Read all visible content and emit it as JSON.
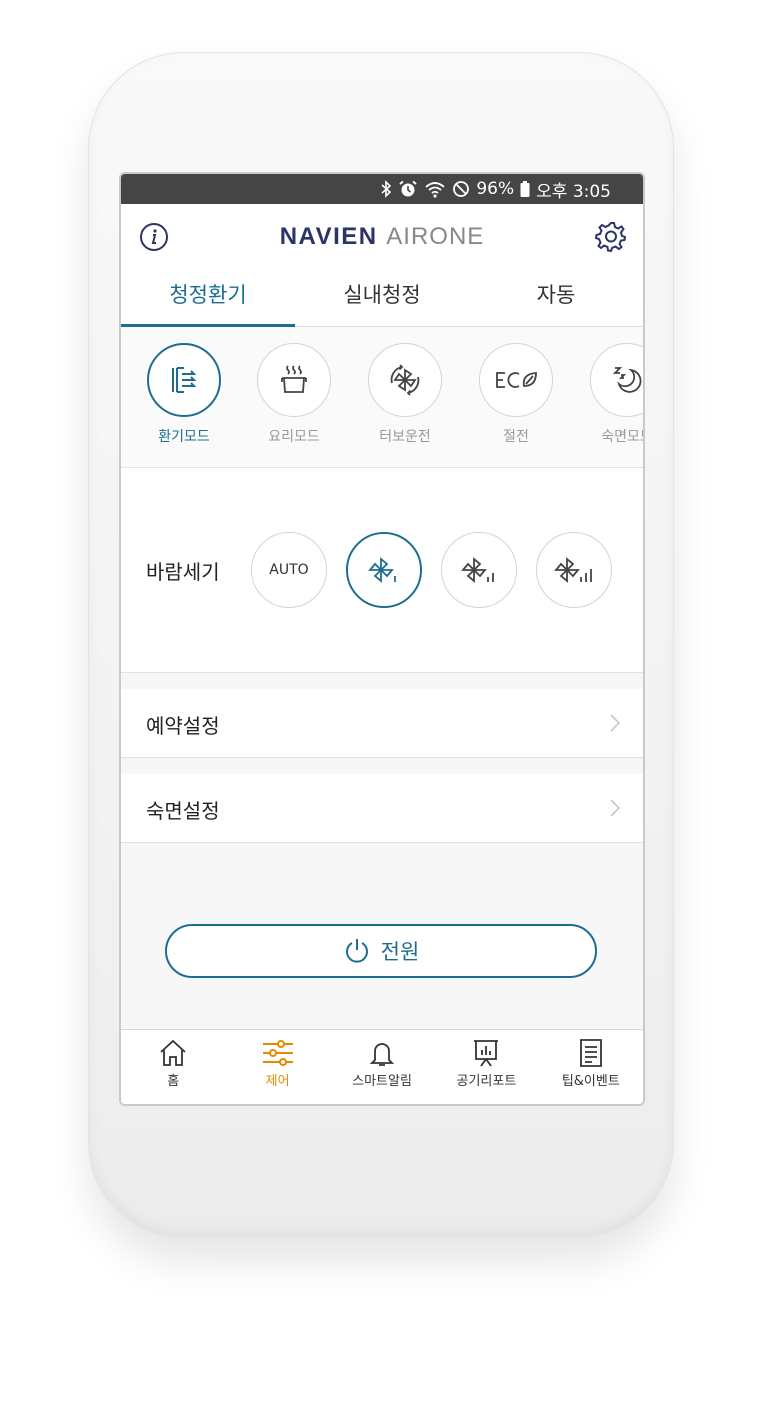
{
  "statusbar": {
    "battery": "96%",
    "time": "오후 3:05"
  },
  "header": {
    "brand_main": "NAVIEN",
    "brand_sub": "AIRONE"
  },
  "tabs": [
    {
      "label": "청정환기",
      "active": true
    },
    {
      "label": "실내청정",
      "active": false
    },
    {
      "label": "자동",
      "active": false
    }
  ],
  "modes": [
    {
      "label": "환기모드",
      "icon": "ventilation-icon",
      "active": true
    },
    {
      "label": "요리모드",
      "icon": "cooking-pot-icon",
      "active": false
    },
    {
      "label": "터보운전",
      "icon": "turbo-fan-icon",
      "active": false
    },
    {
      "label": "절전",
      "icon": "eco-icon",
      "active": false
    },
    {
      "label": "숙면모드",
      "icon": "sleep-moon-icon",
      "active": false
    }
  ],
  "wind": {
    "label": "바람세기",
    "auto_label": "AUTO",
    "selected_level": 1
  },
  "settings": [
    {
      "label": "예약설정"
    },
    {
      "label": "숙면설정"
    }
  ],
  "power": {
    "label": "전원"
  },
  "bottom_nav": [
    {
      "label": "홈",
      "icon": "home-icon",
      "active": false
    },
    {
      "label": "제어",
      "icon": "sliders-icon",
      "active": true
    },
    {
      "label": "스마트알림",
      "icon": "bell-icon",
      "active": false
    },
    {
      "label": "공기리포트",
      "icon": "report-board-icon",
      "active": false
    },
    {
      "label": "팁&이벤트",
      "icon": "document-icon",
      "active": false
    }
  ],
  "colors": {
    "accent": "#1d6d93",
    "nav_active": "#e88a00",
    "brand": "#2a3566"
  }
}
